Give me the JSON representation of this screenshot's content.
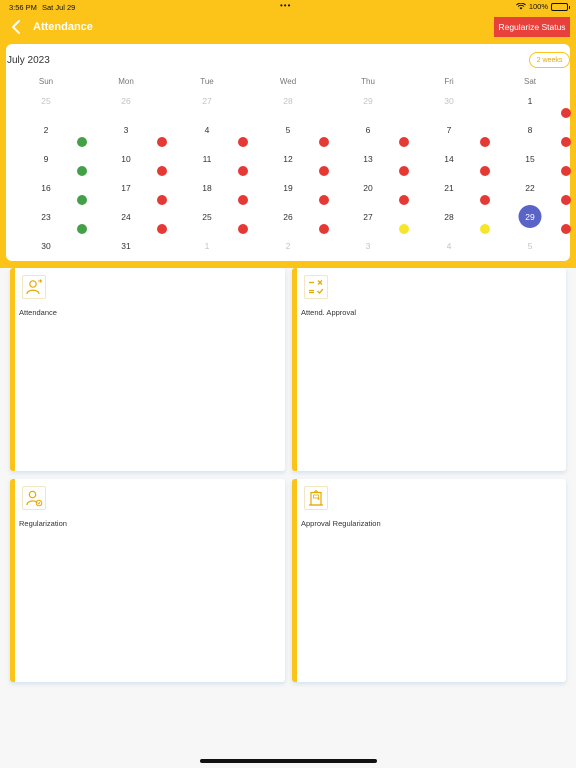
{
  "status_bar": {
    "time": "3:56 PM",
    "date": "Sat Jul 29",
    "dots": "•••",
    "battery": "100%"
  },
  "header": {
    "title": "Attendance",
    "back_icon": "chevron-left-icon",
    "action_label": "Regularize Status"
  },
  "colors": {
    "primary": "#fcc419",
    "action": "#e8403b",
    "present": "#43a047",
    "absent": "#e53935",
    "partial": "#f5e62a",
    "today": "#5a63c7"
  },
  "calendar": {
    "month_label": "July 2023",
    "view_toggle": "2 weeks",
    "weekdays": [
      "Sun",
      "Mon",
      "Tue",
      "Wed",
      "Thu",
      "Fri",
      "Sat"
    ],
    "weeks": [
      [
        {
          "d": "25",
          "m": true,
          "s": null
        },
        {
          "d": "26",
          "m": true,
          "s": null
        },
        {
          "d": "27",
          "m": true,
          "s": null
        },
        {
          "d": "28",
          "m": true,
          "s": null
        },
        {
          "d": "29",
          "m": true,
          "s": null
        },
        {
          "d": "30",
          "m": true,
          "s": null
        },
        {
          "d": "1",
          "m": false,
          "s": "absent"
        }
      ],
      [
        {
          "d": "2",
          "m": false,
          "s": "present"
        },
        {
          "d": "3",
          "m": false,
          "s": "absent"
        },
        {
          "d": "4",
          "m": false,
          "s": "absent"
        },
        {
          "d": "5",
          "m": false,
          "s": "absent"
        },
        {
          "d": "6",
          "m": false,
          "s": "absent"
        },
        {
          "d": "7",
          "m": false,
          "s": "absent"
        },
        {
          "d": "8",
          "m": false,
          "s": "absent"
        }
      ],
      [
        {
          "d": "9",
          "m": false,
          "s": "present"
        },
        {
          "d": "10",
          "m": false,
          "s": "absent"
        },
        {
          "d": "11",
          "m": false,
          "s": "absent"
        },
        {
          "d": "12",
          "m": false,
          "s": "absent"
        },
        {
          "d": "13",
          "m": false,
          "s": "absent"
        },
        {
          "d": "14",
          "m": false,
          "s": "absent"
        },
        {
          "d": "15",
          "m": false,
          "s": "absent"
        }
      ],
      [
        {
          "d": "16",
          "m": false,
          "s": "present"
        },
        {
          "d": "17",
          "m": false,
          "s": "absent"
        },
        {
          "d": "18",
          "m": false,
          "s": "absent"
        },
        {
          "d": "19",
          "m": false,
          "s": "absent"
        },
        {
          "d": "20",
          "m": false,
          "s": "absent"
        },
        {
          "d": "21",
          "m": false,
          "s": "absent"
        },
        {
          "d": "22",
          "m": false,
          "s": "absent"
        }
      ],
      [
        {
          "d": "23",
          "m": false,
          "s": "present"
        },
        {
          "d": "24",
          "m": false,
          "s": "absent"
        },
        {
          "d": "25",
          "m": false,
          "s": "absent"
        },
        {
          "d": "26",
          "m": false,
          "s": "absent"
        },
        {
          "d": "27",
          "m": false,
          "s": "partial"
        },
        {
          "d": "28",
          "m": false,
          "s": "partial"
        },
        {
          "d": "29",
          "m": false,
          "s": "absent",
          "today": true
        }
      ],
      [
        {
          "d": "30",
          "m": false,
          "s": null
        },
        {
          "d": "31",
          "m": false,
          "s": null
        },
        {
          "d": "1",
          "m": true,
          "s": null
        },
        {
          "d": "2",
          "m": true,
          "s": null
        },
        {
          "d": "3",
          "m": true,
          "s": null
        },
        {
          "d": "4",
          "m": true,
          "s": null
        },
        {
          "d": "5",
          "m": true,
          "s": null
        }
      ]
    ]
  },
  "tiles": [
    {
      "label": "Attendance",
      "icon": "user-attendance-icon"
    },
    {
      "label": "Attend. Approval",
      "icon": "calculator-approval-icon"
    },
    {
      "label": "Regularization",
      "icon": "user-check-icon"
    },
    {
      "label": "Approval Regularization",
      "icon": "door-approval-icon"
    }
  ]
}
